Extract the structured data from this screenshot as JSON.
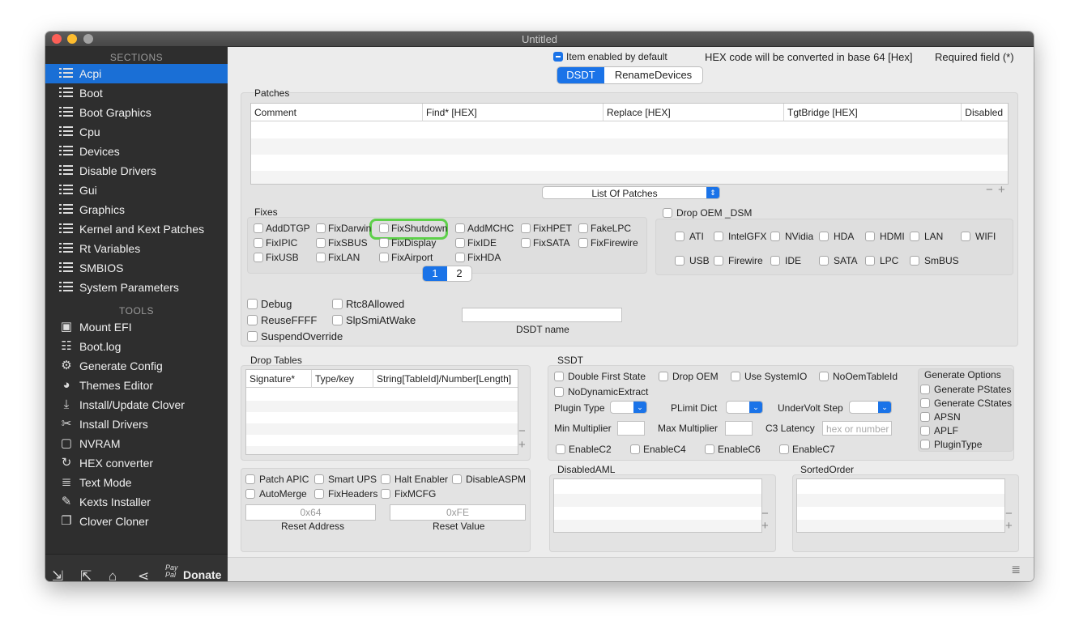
{
  "window": {
    "title": "Untitled"
  },
  "sidebar": {
    "sections_header": "SECTIONS",
    "tools_header": "TOOLS",
    "sections": [
      {
        "label": "Acpi",
        "selected": true
      },
      {
        "label": "Boot"
      },
      {
        "label": "Boot Graphics"
      },
      {
        "label": "Cpu"
      },
      {
        "label": "Devices"
      },
      {
        "label": "Disable Drivers"
      },
      {
        "label": "Gui"
      },
      {
        "label": "Graphics"
      },
      {
        "label": "Kernel and Kext Patches"
      },
      {
        "label": "Rt Variables"
      },
      {
        "label": "SMBIOS"
      },
      {
        "label": "System Parameters"
      }
    ],
    "tools": [
      {
        "label": "Mount EFI",
        "icon": "disk-icon"
      },
      {
        "label": "Boot.log",
        "icon": "log-icon"
      },
      {
        "label": "Generate Config",
        "icon": "gears-icon"
      },
      {
        "label": "Themes Editor",
        "icon": "palette-icon"
      },
      {
        "label": "Install/Update Clover",
        "icon": "download-icon"
      },
      {
        "label": "Install Drivers",
        "icon": "tools-icon"
      },
      {
        "label": "NVRAM",
        "icon": "chip-icon"
      },
      {
        "label": "HEX converter",
        "icon": "refresh-icon"
      },
      {
        "label": "Text Mode",
        "icon": "text-icon"
      },
      {
        "label": "Kexts Installer",
        "icon": "brush-icon"
      },
      {
        "label": "Clover Cloner",
        "icon": "copy-icon"
      }
    ],
    "donate": "Donate",
    "paypal": "Pay Pal"
  },
  "header": {
    "item_enabled": "Item enabled by default",
    "hex_note": "HEX code will be converted in base 64 [Hex]",
    "required": "Required field (*)"
  },
  "tabs": [
    "DSDT",
    "RenameDevices"
  ],
  "patches": {
    "title": "Patches",
    "columns": [
      "Comment",
      "Find* [HEX]",
      "Replace [HEX]",
      "TgtBridge [HEX]",
      "Disabled"
    ],
    "list_popup": "List Of Patches"
  },
  "fixes": {
    "title": "Fixes",
    "items": [
      "AddDTGP",
      "FixDarwin",
      "FixShutdown",
      "AddMCHC",
      "FixHPET",
      "FakeLPC",
      "FixIPIC",
      "FixSBUS",
      "FixDisplay",
      "FixIDE",
      "FixSATA",
      "FixFirewire",
      "FixUSB",
      "FixLAN",
      "FixAirport",
      "FixHDA"
    ],
    "pages": [
      "1",
      "2"
    ]
  },
  "drop_oem": {
    "title": "Drop OEM _DSM",
    "items": [
      "ATI",
      "IntelGFX",
      "NVidia",
      "HDA",
      "HDMI",
      "LAN",
      "WIFI",
      "USB",
      "Firewire",
      "IDE",
      "SATA",
      "LPC",
      "SmBUS"
    ]
  },
  "misc": {
    "items": [
      "Debug",
      "Rtc8Allowed",
      "ReuseFFFF",
      "SlpSmiAtWake",
      "SuspendOverride"
    ],
    "dsdt_name_label": "DSDT name"
  },
  "drop_tables": {
    "title": "Drop Tables",
    "columns": [
      "Signature*",
      "Type/key",
      "String[TableId]/Number[Length]"
    ]
  },
  "ssdt": {
    "title": "SSDT",
    "checks": [
      "Double First State",
      "Drop OEM",
      "Use SystemIO",
      "NoOemTableId",
      "NoDynamicExtract"
    ],
    "plugin_type": "Plugin Type",
    "plimit_dict": "PLimit Dict",
    "undervolt_step": "UnderVolt Step",
    "min_multiplier": "Min Multiplier",
    "max_multiplier": "Max Multiplier",
    "c3_latency": "C3 Latency",
    "c3_placeholder": "hex or number",
    "enables": [
      "EnableC2",
      "EnableC4",
      "EnableC6",
      "EnableC7"
    ]
  },
  "generate_options": {
    "title": "Generate Options",
    "items": [
      "Generate PStates",
      "Generate CStates",
      "APSN",
      "APLF",
      "PluginType"
    ]
  },
  "bottom_left": {
    "items": [
      "Patch APIC",
      "Smart UPS",
      "Halt Enabler",
      "DisableASPM",
      "AutoMerge",
      "FixHeaders",
      "FixMCFG"
    ],
    "reset_address_placeholder": "0x64",
    "reset_value_placeholder": "0xFE",
    "reset_address": "Reset Address",
    "reset_value": "Reset Value"
  },
  "disabled_aml": {
    "title": "DisabledAML"
  },
  "sorted_order": {
    "title": "SortedOrder"
  },
  "colors": {
    "accent": "#1a73e8",
    "sidebar_bg": "#2e2e2e",
    "highlight": "#5ed04a"
  }
}
